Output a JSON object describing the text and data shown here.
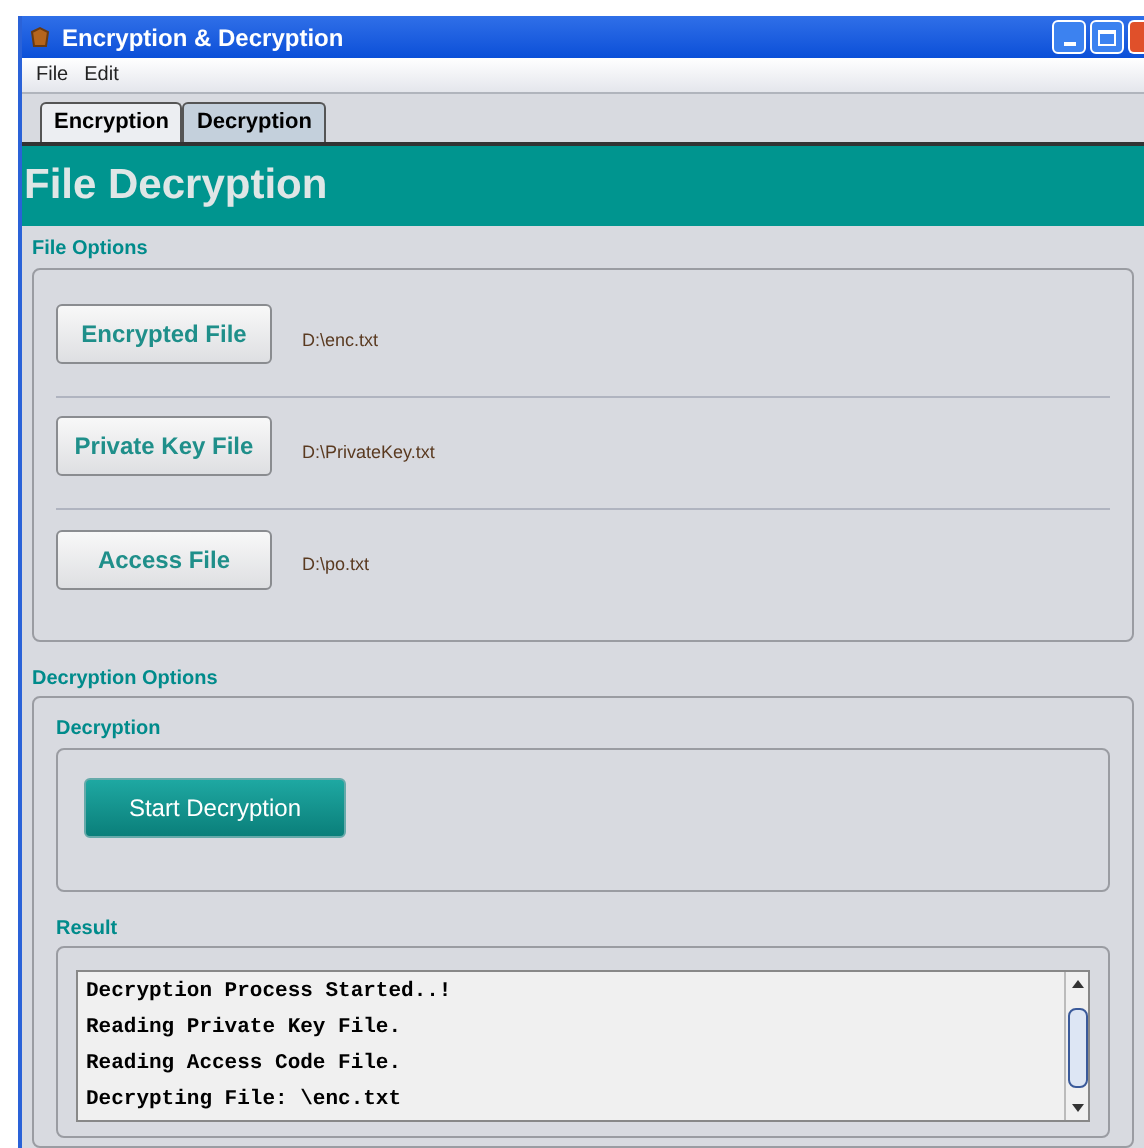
{
  "window": {
    "title": "Encryption & Decryption"
  },
  "menu": [
    "File",
    "Edit"
  ],
  "tabs": [
    {
      "label": "Encryption",
      "selected": false
    },
    {
      "label": "Decryption",
      "selected": true
    }
  ],
  "header": "File Decryption",
  "file_options": {
    "title": "File Options",
    "rows": [
      {
        "button": "Encrypted File",
        "path": "D:\\enc.txt"
      },
      {
        "button": "Private Key File",
        "path": "D:\\PrivateKey.txt"
      },
      {
        "button": "Access File",
        "path": "D:\\po.txt"
      }
    ]
  },
  "decryption_options": {
    "title": "Decryption Options",
    "decryption": {
      "title": "Decryption",
      "button": "Start Decryption"
    },
    "result": {
      "title": "Result",
      "lines": [
        "Decryption Process Started..!",
        "Reading Private Key File.",
        "Reading Access Code File.",
        "Decrypting File: \\enc.txt"
      ]
    }
  }
}
